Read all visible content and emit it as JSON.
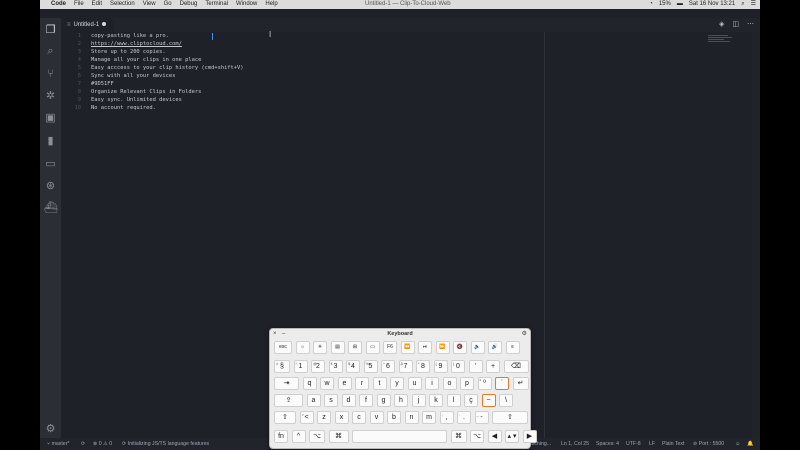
{
  "menubar": {
    "apple": "",
    "items": [
      "Code",
      "File",
      "Edit",
      "Selection",
      "View",
      "Go",
      "Debug",
      "Terminal",
      "Window",
      "Help"
    ],
    "window_title": "Untitled-1 — Clip-To-Cloud-Web",
    "battery": "15%",
    "clock": "Sat 16 Nov 13:21"
  },
  "activity": [
    {
      "name": "explorer-icon",
      "glyph": "❐",
      "badge": "1"
    },
    {
      "name": "search-icon",
      "glyph": "⌕"
    },
    {
      "name": "source-control-icon",
      "glyph": "⑂",
      "badge": "3"
    },
    {
      "name": "debug-icon",
      "glyph": "✲"
    },
    {
      "name": "extensions-icon",
      "glyph": "▣"
    },
    {
      "name": "bookmarks-icon",
      "glyph": "▮"
    },
    {
      "name": "folder-icon",
      "glyph": "▭"
    },
    {
      "name": "git-graph-icon",
      "glyph": "⊛"
    },
    {
      "name": "docker-icon",
      "glyph": "⛴"
    }
  ],
  "tab": {
    "icon": "≡",
    "label": "Untitled-1"
  },
  "editor": {
    "lines": [
      {
        "num": "1",
        "text": "copy-pasting like a pro."
      },
      {
        "num": "2",
        "text": "https://www.cliptocloud.com/",
        "link": true
      },
      {
        "num": "3",
        "text": "Store up to 200 copies."
      },
      {
        "num": "4",
        "text": "Manage all your clips in one place"
      },
      {
        "num": "5",
        "text": "Easy acccess to your clip history (cmd+shift+V)"
      },
      {
        "num": "6",
        "text": "Sync with all your devices"
      },
      {
        "num": "7",
        "text": "#9D51FF"
      },
      {
        "num": "8",
        "text": "Organize Relevant Clips in Folders"
      },
      {
        "num": "9",
        "text": "Easy sync. Unlimited devices"
      },
      {
        "num": "10",
        "text": "No account required."
      }
    ]
  },
  "statusbar": {
    "branch": "master*",
    "errors": "0",
    "warnings": "0",
    "task": "Initializing JS/TS language features",
    "watching": "atching...",
    "position": "Ln 1, Col 25",
    "spaces": "Spaces: 4",
    "encoding": "UTF-8",
    "eol": "LF",
    "language": "Plain Text",
    "port": "Port : 5500"
  },
  "keyboard": {
    "title": "Keyboard",
    "rows": [
      [
        [
          "esc",
          "",
          20
        ],
        [
          "☼",
          "",
          16
        ],
        [
          "☀",
          "",
          16
        ],
        [
          "▤",
          "",
          16
        ],
        [
          "⊞",
          "",
          16
        ],
        [
          "▭",
          "",
          16
        ],
        [
          "F6",
          "",
          16
        ],
        [
          "⏪",
          "",
          16
        ],
        [
          "⏯",
          "",
          16
        ],
        [
          "⏩",
          "",
          16
        ],
        [
          "🔇",
          "",
          16
        ],
        [
          "🔈",
          "",
          16
        ],
        [
          "🔊",
          "",
          16
        ],
        [
          "≡",
          "",
          16
        ]
      ],
      [
        [
          "§",
          "±",
          18
        ],
        [
          "1",
          "!",
          16
        ],
        [
          "2",
          "@",
          16
        ],
        [
          "3",
          "£",
          16
        ],
        [
          "4",
          "$",
          16
        ],
        [
          "5",
          "%",
          16
        ],
        [
          "6",
          "^",
          16
        ],
        [
          "7",
          "&",
          16
        ],
        [
          "8",
          "*",
          16
        ],
        [
          "9",
          "(",
          16
        ],
        [
          "0",
          ")",
          16
        ],
        [
          "'",
          "",
          16
        ],
        [
          "+",
          "",
          16
        ],
        [
          "⌫",
          "",
          27
        ]
      ],
      [
        [
          "⇥",
          "",
          27
        ],
        [
          "q",
          "",
          16
        ],
        [
          "w",
          "",
          16
        ],
        [
          "e",
          "",
          16
        ],
        [
          "r",
          "",
          16
        ],
        [
          "t",
          "",
          16
        ],
        [
          "y",
          "",
          16
        ],
        [
          "u",
          "",
          16
        ],
        [
          "i",
          "",
          16
        ],
        [
          "o",
          "",
          16
        ],
        [
          "p",
          "",
          16
        ],
        [
          "º",
          "ª",
          16
        ],
        [
          "´",
          "",
          16,
          "hl"
        ],
        [
          "↵",
          "",
          18
        ]
      ],
      [
        [
          "⇪",
          "",
          31
        ],
        [
          "a",
          "",
          16
        ],
        [
          "s",
          "",
          16
        ],
        [
          "d",
          "",
          16
        ],
        [
          "f",
          "",
          16
        ],
        [
          "g",
          "",
          16
        ],
        [
          "h",
          "",
          16
        ],
        [
          "j",
          "",
          16
        ],
        [
          "k",
          "",
          16
        ],
        [
          "l",
          "",
          16
        ],
        [
          "ç",
          "",
          16
        ],
        [
          "~",
          "",
          16,
          "hl"
        ],
        [
          "\\",
          "",
          16
        ]
      ],
      [
        [
          "⇧",
          "",
          24
        ],
        [
          "<",
          ">",
          16
        ],
        [
          "z",
          "",
          16
        ],
        [
          "x",
          "",
          16
        ],
        [
          "c",
          "",
          16
        ],
        [
          "v",
          "",
          16
        ],
        [
          "b",
          "",
          16
        ],
        [
          "n",
          "",
          16
        ],
        [
          "m",
          "",
          16
        ],
        [
          ",",
          ";",
          16
        ],
        [
          ".",
          ":",
          16
        ],
        [
          "-",
          "_",
          16
        ],
        [
          "⇧",
          "",
          38
        ]
      ],
      [
        [
          "fn",
          "",
          16
        ],
        [
          "^",
          "",
          16
        ],
        [
          "⌥",
          "",
          18
        ],
        [
          "⌘",
          "",
          22
        ],
        [
          "",
          "",
          97
        ],
        [
          "⌘",
          "",
          18
        ],
        [
          "⌥",
          "",
          16
        ],
        [
          "◀",
          "",
          16
        ],
        [
          "▴ ▾",
          "",
          16
        ],
        [
          "▶",
          "",
          16
        ]
      ]
    ]
  },
  "colors": {
    "editor_bg": "#1e2228",
    "sidebar_bg": "#2b2e35",
    "accent": "#2f7fd6",
    "highlight_key": "#e27a2e"
  }
}
